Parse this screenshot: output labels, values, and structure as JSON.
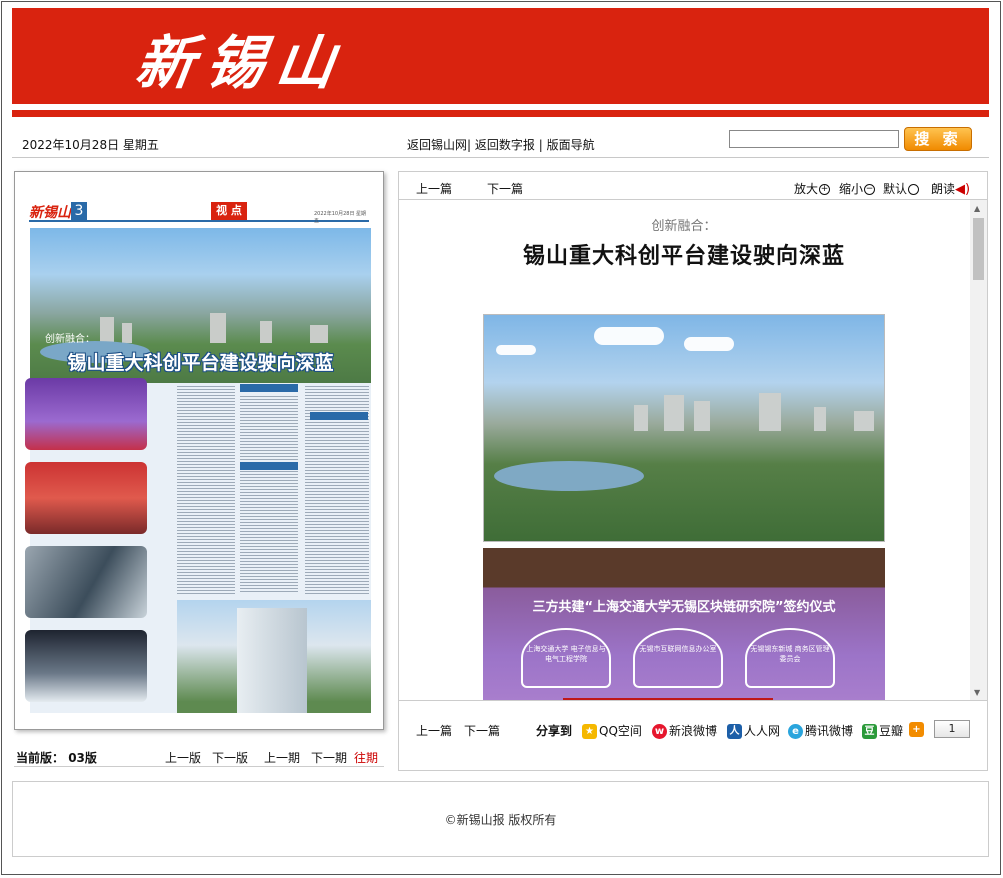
{
  "masthead": {
    "logo_text": "新锡山"
  },
  "topbar": {
    "date": "2022年10月28日 星期五",
    "link_home": "返回锡山网",
    "sep1": "| ",
    "link_digital": "返回数字报",
    "sep2": " | ",
    "link_nav": "版面导航",
    "search_value": "",
    "search_button": "搜 索"
  },
  "page_preview": {
    "logo": "新锡山",
    "page_number": "3",
    "section_tag": "视 点",
    "subtitle": "创新融合：",
    "title": "锡山重大科创平台建设驶向深蓝"
  },
  "page_nav": {
    "current_label": "当前版：",
    "current_value": "03版",
    "prev_edition": "上一版",
    "next_edition": "下一版",
    "prev_issue": "上一期",
    "next_issue": "下一期",
    "past_issues": "往期"
  },
  "article": {
    "toolbar": {
      "prev": "上一篇",
      "next": "下一篇",
      "zoom_in": "放大",
      "zoom_out": "缩小",
      "default": "默认",
      "read_aloud": "朗读"
    },
    "kicker": "创新融合：",
    "headline": "锡山重大科创平台建设驶向深蓝",
    "image2_banner": "三方共建“上海交通大学无锡区块链研究院”签约仪式",
    "image2_sign1": "上海交通大学 电子信息与电气工程学院",
    "image2_sign2": "无锡市互联网信息办公室",
    "image2_sign3": "无锡锡东新城 商务区管理委员会",
    "bottom": {
      "prev": "上一篇",
      "next": "下一篇",
      "share_label": "分享到",
      "share_qzone": "QQ空间",
      "share_weibo": "新浪微博",
      "share_renren": "人人网",
      "share_tencent": "腾讯微博",
      "share_douban": "豆瓣",
      "counter": "1"
    }
  },
  "footer": {
    "copyright": "©新锡山报 版权所有"
  },
  "colors": {
    "brand_red": "#d9230f",
    "link_red": "#c00000"
  }
}
